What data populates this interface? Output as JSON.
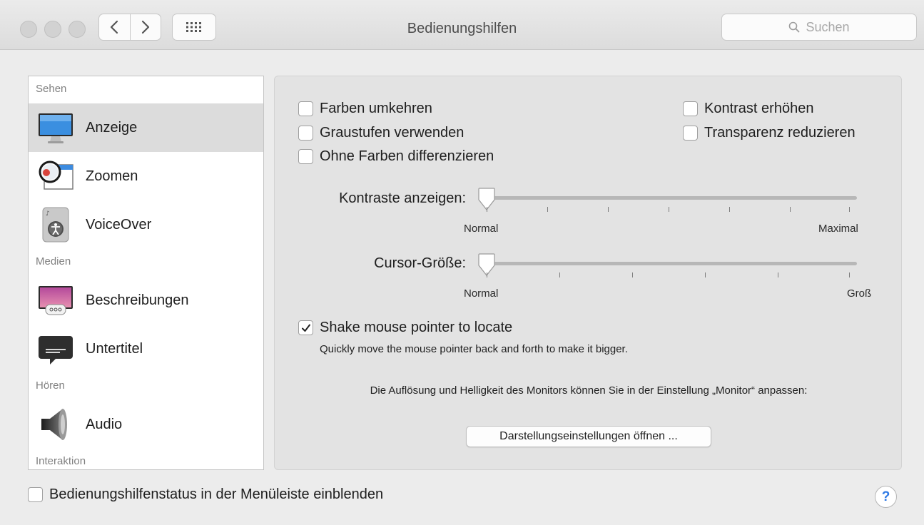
{
  "window": {
    "title": "Bedienungshilfen"
  },
  "search": {
    "placeholder": "Suchen"
  },
  "icons": {
    "back": "chevron-left-icon",
    "forward": "chevron-right-icon",
    "show_all": "grid-icon",
    "search": "magnifier-icon",
    "checkmark": "checkmark-icon",
    "help": "question-mark-icon"
  },
  "sidebar": {
    "sections": [
      {
        "title": "Sehen",
        "items": [
          "Anzeige",
          "Zoomen",
          "VoiceOver"
        ]
      },
      {
        "title": "Medien",
        "items": [
          "Beschreibungen",
          "Untertitel"
        ]
      },
      {
        "title": "Hören",
        "items": [
          "Audio"
        ]
      },
      {
        "title": "Interaktion",
        "items": []
      }
    ],
    "selected": "Anzeige"
  },
  "display": {
    "checkboxes": {
      "invert": {
        "label": "Farben umkehren",
        "checked": false
      },
      "grayscale": {
        "label": "Graustufen verwenden",
        "checked": false
      },
      "differentiate": {
        "label": "Ohne Farben differenzieren",
        "checked": false
      },
      "contrast": {
        "label": "Kontrast erhöhen",
        "checked": false
      },
      "transparency": {
        "label": "Transparenz reduzieren",
        "checked": false
      }
    },
    "contrast_slider": {
      "label": "Kontraste anzeigen:",
      "min_label": "Normal",
      "max_label": "Maximal",
      "value": 0,
      "ticks": 7
    },
    "cursor_slider": {
      "label": "Cursor-Größe:",
      "min_label": "Normal",
      "max_label": "Groß",
      "value": 0,
      "ticks": 5
    },
    "shake": {
      "label": "Shake mouse pointer to locate",
      "checked": true,
      "description": "Quickly move the mouse pointer back and forth to make it bigger."
    },
    "monitor_info": "Die Auflösung und Helligkeit des Monitors können Sie in der Einstellung „Monitor“ anpassen:",
    "open_button": "Darstellungseinstellungen öffnen ..."
  },
  "bottom": {
    "status_checkbox": {
      "label": "Bedienungshilfenstatus in der Menüleiste einblenden",
      "checked": false
    },
    "help_label": "?"
  },
  "colors": {
    "accent": "#2f7ae5",
    "selection": "#dcdcdc",
    "background": "#ececec"
  }
}
